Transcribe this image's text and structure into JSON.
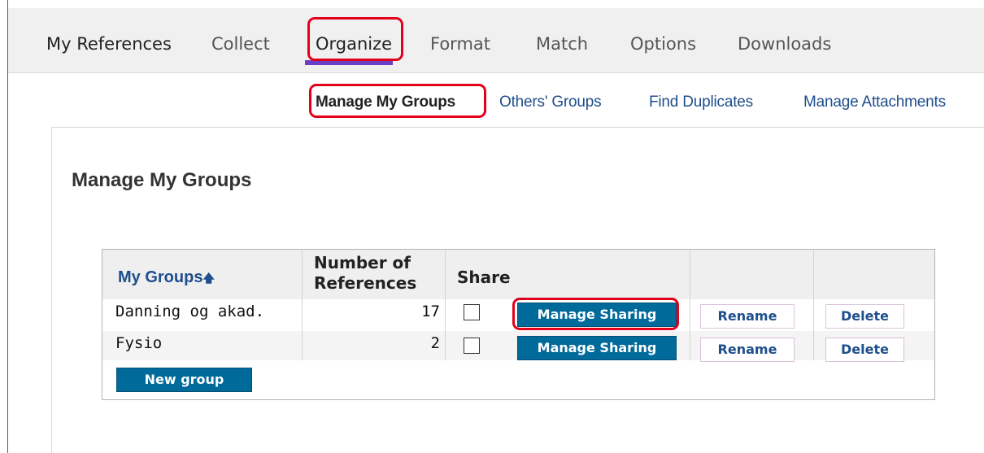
{
  "top_nav": {
    "tabs": [
      {
        "label": "My References"
      },
      {
        "label": "Collect"
      },
      {
        "label": "Organize"
      },
      {
        "label": "Format"
      },
      {
        "label": "Match"
      },
      {
        "label": "Options"
      },
      {
        "label": "Downloads"
      }
    ],
    "active_tab": "Organize"
  },
  "sub_nav": {
    "links": [
      {
        "label": "Manage My Groups"
      },
      {
        "label": "Others' Groups"
      },
      {
        "label": "Find Duplicates"
      },
      {
        "label": "Manage Attachments"
      }
    ],
    "current": "Manage My Groups"
  },
  "page": {
    "title": "Manage My Groups"
  },
  "groups_table": {
    "headers": {
      "groups": "My Groups",
      "refs_line1": "Number of",
      "refs_line2": "References",
      "share": "Share"
    },
    "rows": [
      {
        "name": "Danning og akad.",
        "count": "17",
        "shared": false,
        "manage_label": "Manage Sharing",
        "rename_label": "Rename",
        "delete_label": "Delete"
      },
      {
        "name": "Fysio",
        "count": "2",
        "shared": false,
        "manage_label": "Manage Sharing",
        "rename_label": "Rename",
        "delete_label": "Delete"
      }
    ],
    "new_group_label": "New group"
  },
  "colors": {
    "accent": "#6a3fc6",
    "highlight": "#e3001b",
    "primary_button": "#006a9a",
    "link": "#1f4e8c"
  }
}
